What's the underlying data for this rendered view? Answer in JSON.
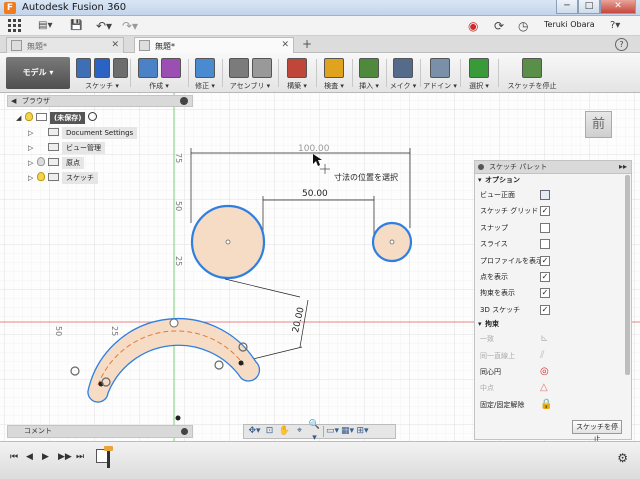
{
  "window": {
    "title": "Autodesk Fusion 360",
    "minimize": "─",
    "maximize": "□",
    "close": "✕",
    "app_icon_letter": "F"
  },
  "appbar": {
    "grid_icon": "grid-icon",
    "user_name": "Teruki Obara",
    "file_glyph": "▤▾",
    "save_glyph": "💾",
    "undo_glyph": "↶▾",
    "redo_glyph": "↷▾",
    "record_glyph": "◉",
    "jobs_glyph": "⟳",
    "clock_glyph": "◷",
    "help_glyph": "?▾"
  },
  "doc_tabs": [
    {
      "label": "無題*",
      "active": false
    },
    {
      "label": "無題*",
      "active": true
    }
  ],
  "toolbar": {
    "mode_label": "モデル ▾",
    "groups": [
      {
        "label": "スケッチ ▾",
        "colors": [
          "#3d6fb6",
          "#2b63c4",
          "#6d6d6d"
        ]
      },
      {
        "label": "作成 ▾",
        "colors": [
          "#4b82c7",
          "#9b4fb3"
        ]
      },
      {
        "label": "修正 ▾",
        "colors": [
          "#4a8ad1"
        ]
      },
      {
        "label": "アセンブリ ▾",
        "colors": [
          "#7b7b7b",
          "#999999"
        ]
      },
      {
        "label": "構築 ▾",
        "colors": [
          "#c0463a"
        ]
      },
      {
        "label": "検査 ▾",
        "colors": [
          "#e0a31e"
        ]
      },
      {
        "label": "挿入 ▾",
        "colors": [
          "#4f8a3c"
        ]
      },
      {
        "label": "メイク ▾",
        "colors": [
          "#556b8c"
        ]
      },
      {
        "label": "アドイン ▾",
        "colors": [
          "#7a8fa8"
        ]
      },
      {
        "label": "選択 ▾",
        "colors": [
          "#3a9a3a"
        ]
      },
      {
        "label": "スケッチを停止",
        "colors": [
          "#5a8f4a"
        ]
      }
    ]
  },
  "browser": {
    "title": "ブラウザ",
    "items": [
      {
        "label": "(未保存)",
        "kind": "root"
      },
      {
        "label": "Document Settings",
        "kind": "settings"
      },
      {
        "label": "ビュー管理",
        "kind": "folder"
      },
      {
        "label": "原点",
        "kind": "folder-bulb-off"
      },
      {
        "label": "スケッチ",
        "kind": "folder-bulb"
      }
    ]
  },
  "comment_bar": {
    "label": "コメント"
  },
  "viewcube": {
    "face": "前"
  },
  "sketch": {
    "dim_total": "100.00",
    "dim_between": "50.00",
    "dim_slot": "20.00",
    "tooltip": "寸法の位置を選択",
    "ruler_v": [
      "75",
      "50",
      "25"
    ],
    "ruler_h": [
      "50",
      "25"
    ]
  },
  "palette": {
    "title": "スケッチ パレット",
    "options_title": "オプション",
    "options": [
      {
        "label": "ビュー正面",
        "control": "icon",
        "checked": false
      },
      {
        "label": "スケッチ グリッド",
        "control": "checkbox",
        "checked": true
      },
      {
        "label": "スナップ",
        "control": "checkbox",
        "checked": false
      },
      {
        "label": "スライス",
        "control": "checkbox",
        "checked": false
      },
      {
        "label": "プロファイルを表示",
        "control": "checkbox",
        "checked": true
      },
      {
        "label": "点を表示",
        "control": "checkbox",
        "checked": true
      },
      {
        "label": "拘束を表示",
        "control": "checkbox",
        "checked": true
      },
      {
        "label": "3D スケッチ",
        "control": "checkbox",
        "checked": true
      }
    ],
    "constraints_title": "拘束",
    "constraints": [
      {
        "label": "一致",
        "enabled": false,
        "glyph": "⊾"
      },
      {
        "label": "同一直線上",
        "enabled": false,
        "glyph": "⫽"
      },
      {
        "label": "同心円",
        "enabled": true,
        "glyph": "◎"
      },
      {
        "label": "中点",
        "enabled": false,
        "glyph": "△"
      },
      {
        "label": "固定/固定解除",
        "enabled": true,
        "glyph": "🔒"
      }
    ],
    "stop_button": "スケッチを停止"
  },
  "colors": {
    "sketch_blue": "#2f7fe0",
    "profile_fill": "#f6dcc4",
    "axis_red": "#e06060",
    "axis_green": "#5fbf5f"
  },
  "navbar": {
    "items": [
      "✥▾",
      "⊡",
      "✋",
      "⌖",
      "🔍▾",
      "▭▾",
      "▦▾",
      "⊞▾"
    ]
  },
  "timeline": {
    "buttons": [
      "⏮",
      "◀",
      "▶",
      "▶▶",
      "⏭"
    ],
    "settings_glyph": "⚙"
  }
}
